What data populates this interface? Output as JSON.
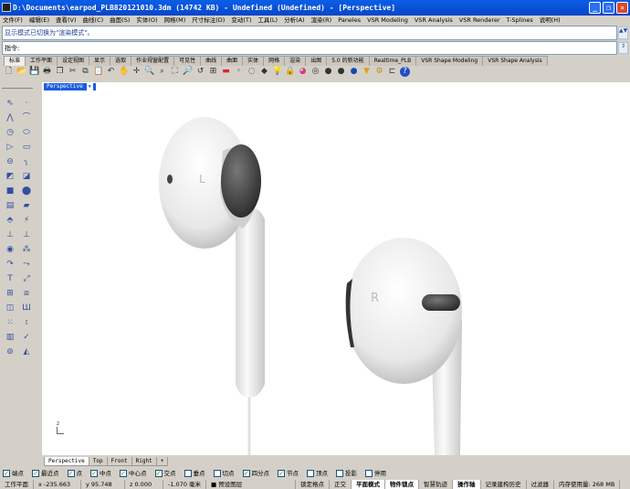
{
  "title": "D:\\Documents\\earpod_PLB820121010.3dm (14742 KB) - Undefined (Undefined) - [Perspective]",
  "menu": [
    "文件(F)",
    "编辑(E)",
    "查看(V)",
    "曲线(C)",
    "曲面(S)",
    "实体(O)",
    "网格(M)",
    "尺寸标注(D)",
    "变动(T)",
    "工具(L)",
    "分析(A)",
    "渲染(R)",
    "Paneles",
    "VSR Modeling",
    "VSR Analysis",
    "VSR Renderer",
    "T-Splines",
    "说明(H)"
  ],
  "command": {
    "history": "显示模式已切换为\"渲染模式\"。",
    "prompt": "指令:"
  },
  "toolbar_tabs": [
    "标准",
    "工作平面",
    "设定视图",
    "显示",
    "选取",
    "作业视窗配置",
    "可见性",
    "曲线",
    "曲面",
    "实体",
    "网格",
    "渲染",
    "出图",
    "5.0 的新功能",
    "Realtime_PLB",
    "VSR Shape Modeling",
    "VSR Shape Analysis"
  ],
  "toolbar_icons": [
    "new-icon",
    "open-icon",
    "save-icon",
    "print-icon",
    "properties-icon",
    "cut-icon",
    "copy-icon",
    "paste-icon",
    "undo-icon",
    "pan-icon",
    "rotate-icon",
    "zoom-icon",
    "zoom-window-icon",
    "zoom-extents-icon",
    "zoom-selected-icon",
    "undo-view-icon",
    "four-viewports-icon",
    "car-icon",
    "osnap-icon",
    "circle-icon",
    "layer-icon",
    "light-icon",
    "lock-icon",
    "color-icon",
    "wheel-icon",
    "sphere-gray-icon",
    "sphere-dark-icon",
    "sphere-blue-icon",
    "flashlight-icon",
    "gear-icon",
    "network-icon",
    "help-icon"
  ],
  "viewport": {
    "name": "Perspective",
    "labels": {
      "left": "L",
      "right": "R"
    },
    "axis": "z"
  },
  "viewport_tabs": [
    "Perspective",
    "Top",
    "Front",
    "Right",
    "+"
  ],
  "osnap": [
    {
      "label": "端点",
      "checked": true
    },
    {
      "label": "最近点",
      "checked": true
    },
    {
      "label": "点",
      "checked": true
    },
    {
      "label": "中点",
      "checked": true
    },
    {
      "label": "中心点",
      "checked": true
    },
    {
      "label": "交点",
      "checked": true
    },
    {
      "label": "垂点",
      "checked": false
    },
    {
      "label": "切点",
      "checked": false
    },
    {
      "label": "四分点",
      "checked": true
    },
    {
      "label": "节点",
      "checked": true
    },
    {
      "label": "顶点",
      "checked": false
    },
    {
      "label": "投影",
      "checked": false
    },
    {
      "label": "停用",
      "checked": false
    }
  ],
  "status": {
    "cplane": "工作平面",
    "x": "x -235.663",
    "y": "y 95.748",
    "z": "z 0.000",
    "dist": "-1.070 毫米",
    "layer": "预设图层",
    "toggles": [
      {
        "label": "锁定格点",
        "on": false
      },
      {
        "label": "正交",
        "on": false
      },
      {
        "label": "平面模式",
        "on": true
      },
      {
        "label": "物件锁点",
        "on": true
      },
      {
        "label": "智慧轨迹",
        "on": false
      },
      {
        "label": "操作轴",
        "on": true
      },
      {
        "label": "记录建构历史",
        "on": false
      },
      {
        "label": "过滤器",
        "on": false
      }
    ],
    "memory": "内存使用量: 268 MB"
  }
}
